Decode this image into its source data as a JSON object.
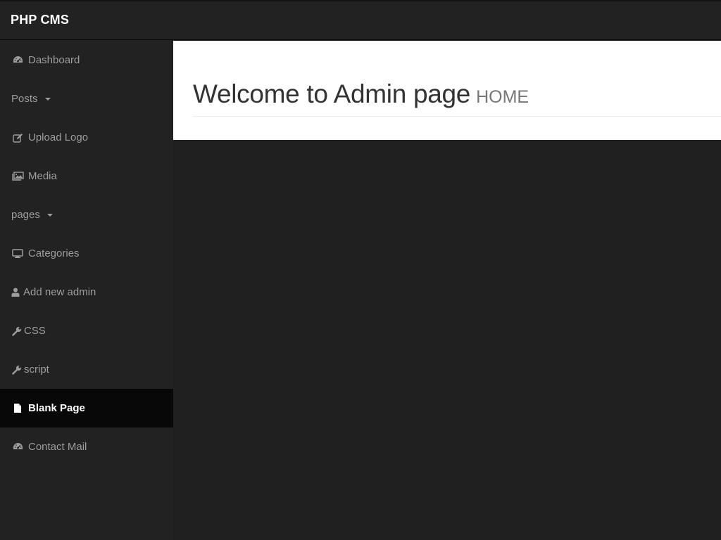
{
  "brand": "PHP CMS",
  "sidebar": {
    "items": [
      {
        "label": "Dashboard",
        "icon": "dashboard-icon"
      },
      {
        "label": "Posts",
        "icon": "",
        "dropdown": true
      },
      {
        "label": "Upload Logo",
        "icon": "edit-icon"
      },
      {
        "label": "Media",
        "icon": "picture-icon"
      },
      {
        "label": "pages",
        "icon": "",
        "dropdown": true
      },
      {
        "label": "Categories",
        "icon": "desktop-icon"
      },
      {
        "label": "Add new admin",
        "icon": "user-icon"
      },
      {
        "label": "CSS",
        "icon": "wrench-icon"
      },
      {
        "label": "script",
        "icon": "wrench-icon"
      },
      {
        "label": "Blank Page",
        "icon": "file-icon",
        "active": true
      },
      {
        "label": "Contact Mail",
        "icon": "dashboard-icon"
      }
    ]
  },
  "main": {
    "title": "Welcome to Admin page",
    "subtitle": "HOME"
  },
  "colors": {
    "navbar": "#222222",
    "sidebar_text": "#9d9d9d",
    "active_bg": "#080808",
    "panel": "#ffffff"
  }
}
